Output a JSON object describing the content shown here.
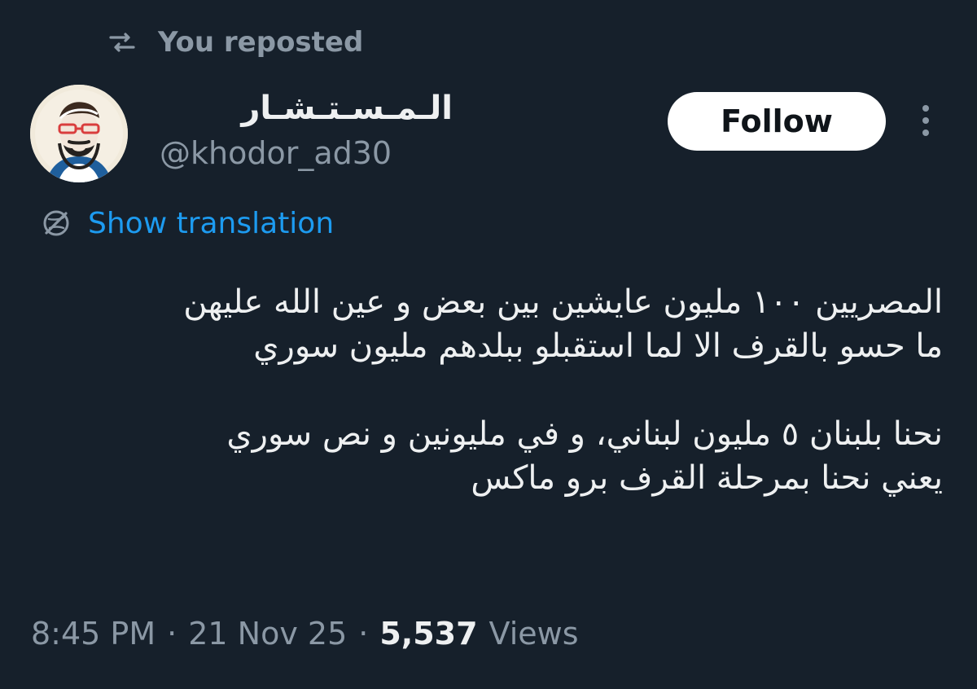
{
  "repost": {
    "label": "You reposted",
    "icon": "repost-icon"
  },
  "author": {
    "display_name": "الـمـسـتـشـار",
    "handle": "@khodor_ad30",
    "avatar_icon": "avatar"
  },
  "actions": {
    "follow_label": "Follow",
    "more_icon": "more-icon"
  },
  "translation": {
    "label": "Show translation",
    "icon": "translate-icon"
  },
  "tweet": {
    "text": "المصريين ١٠٠ مليون عايشين بين بعض و عين الله عليهن\nما حسو بالقرف الا لما استقبلو ببلدهم مليون سوري\n\nنحنا بلبنان ٥ مليون لبناني، و في مليونين و نص سوري\nيعني نحنا بمرحلة القرف برو ماكس"
  },
  "meta": {
    "time": "8:45 PM",
    "date": "21 Nov 25",
    "views_count": "5,537",
    "views_label": "Views",
    "separator": "·"
  },
  "colors": {
    "background": "#16202b",
    "text": "#eef0f1",
    "muted": "#8b98a5",
    "accent": "#1d9bf0",
    "button": "#ffffff"
  }
}
